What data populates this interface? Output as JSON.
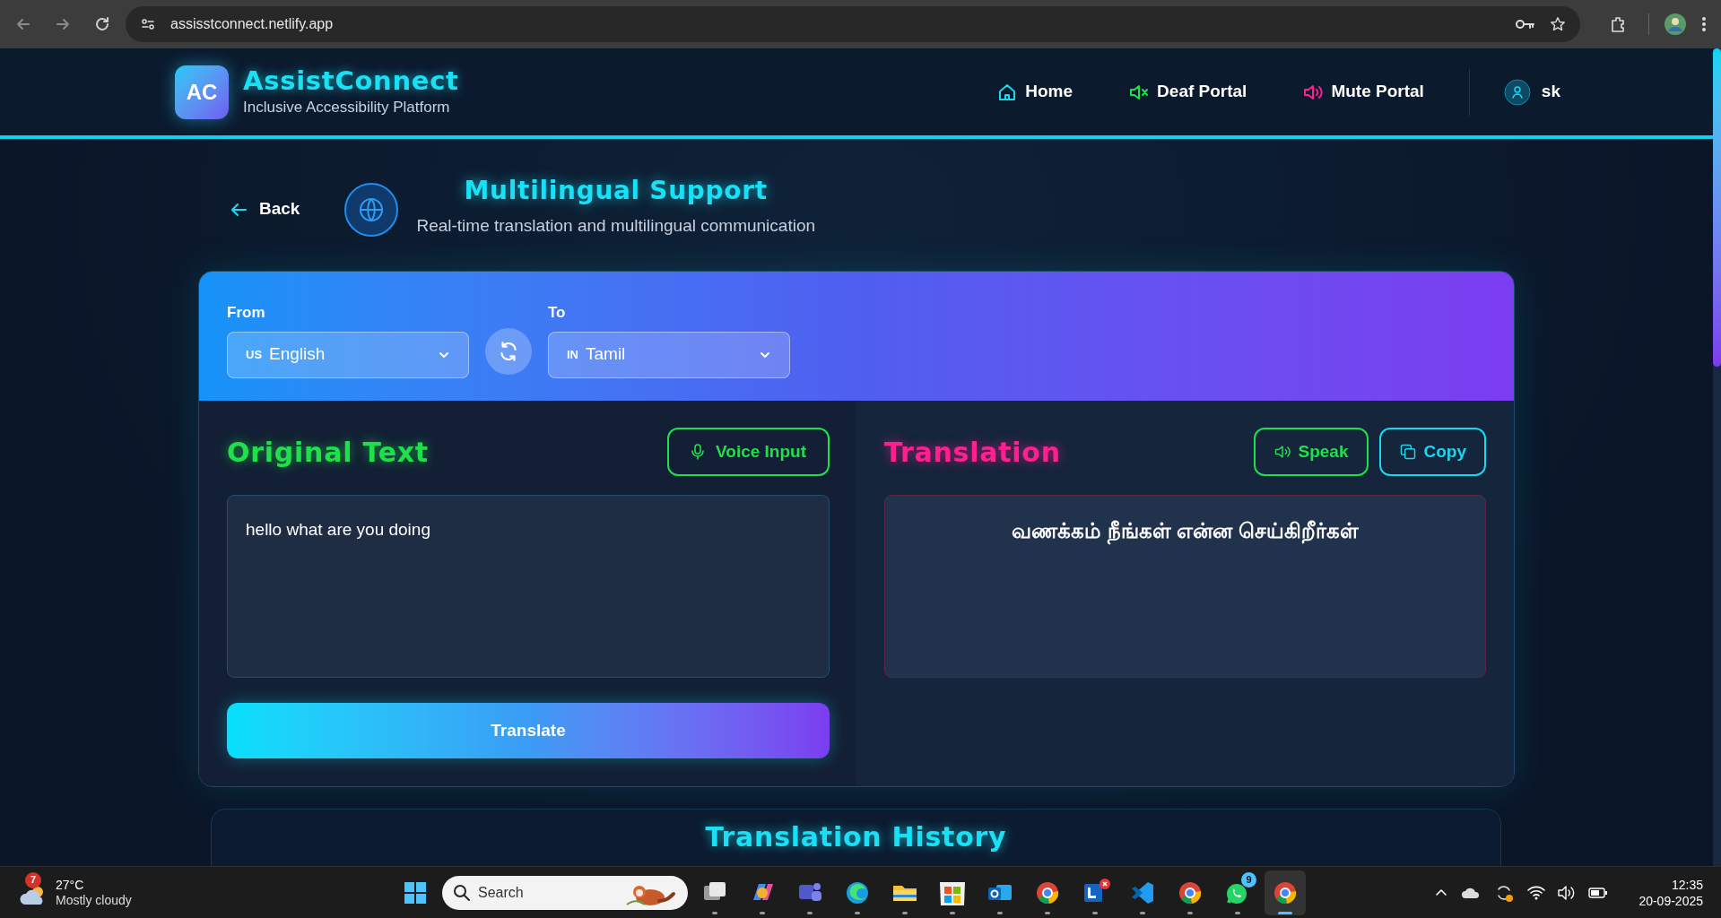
{
  "browser": {
    "url": "assisstconnect.netlify.app"
  },
  "header": {
    "logo_initials": "AC",
    "brand": "AssistConnect",
    "tagline": "Inclusive Accessibility Platform",
    "nav": [
      {
        "label": "Home",
        "kind": "home"
      },
      {
        "label": "Deaf Portal",
        "kind": "deaf"
      },
      {
        "label": "Mute Portal",
        "kind": "mute"
      }
    ],
    "user": "sk"
  },
  "page": {
    "back": "Back",
    "title": "Multilingual Support",
    "subtitle": "Real-time translation and multilingual communication"
  },
  "translator": {
    "from_label": "From",
    "from": {
      "flag": "US",
      "language": "English"
    },
    "to_label": "To",
    "to": {
      "flag": "IN",
      "language": "Tamil"
    },
    "original": {
      "heading": "Original Text",
      "voice_button": "Voice Input",
      "value": "hello what are you doing",
      "action": "Translate"
    },
    "translation": {
      "heading": "Translation",
      "buttons": [
        {
          "label": "Speak",
          "kind": "speak"
        },
        {
          "label": "Copy",
          "kind": "copy"
        }
      ],
      "text": "வணக்கம் நீங்கள் என்ன செய்கிறீர்கள்"
    }
  },
  "history": {
    "title": "Translation History"
  },
  "taskbar": {
    "weather": {
      "badge": "7",
      "temp": "27°C",
      "condition": "Mostly cloudy"
    },
    "search_placeholder": "Search",
    "apps": [
      {
        "kind": "taskview",
        "selected": false
      },
      {
        "kind": "copilot",
        "selected": false
      },
      {
        "kind": "teams",
        "selected": false
      },
      {
        "kind": "edge",
        "selected": false
      },
      {
        "kind": "files",
        "selected": false
      },
      {
        "kind": "store",
        "selected": false
      },
      {
        "kind": "outlook",
        "selected": false
      },
      {
        "kind": "chrome",
        "selected": false
      },
      {
        "kind": "lapp",
        "selected": false
      },
      {
        "kind": "vscode",
        "selected": false
      },
      {
        "kind": "chrome",
        "selected": false
      },
      {
        "kind": "whatsapp",
        "badge": "9",
        "selected": false
      },
      {
        "kind": "chrome",
        "selected": true
      }
    ],
    "time": "12:35",
    "date": "20-09-2025"
  }
}
